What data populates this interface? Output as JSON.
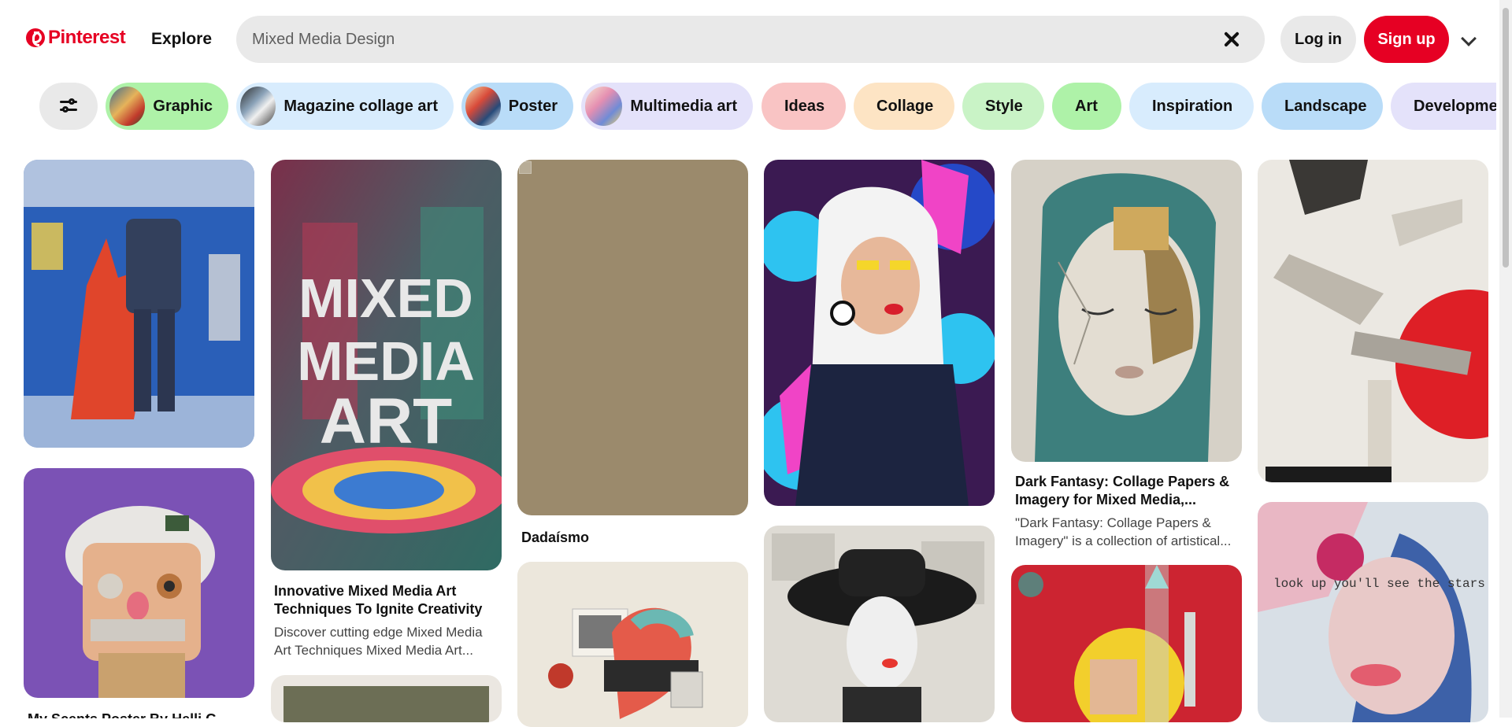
{
  "header": {
    "logo_text": "Pinterest",
    "explore_label": "Explore",
    "search_value": "Mixed Media Design",
    "login_label": "Log in",
    "signup_label": "Sign up"
  },
  "chips": [
    {
      "label": "Graphic",
      "bg": "#aef2a8"
    },
    {
      "label": "Magazine collage art",
      "bg": "#d8ecfd"
    },
    {
      "label": "Poster",
      "bg": "#b9dcf8"
    },
    {
      "label": "Multimedia art",
      "bg": "#e4e2fa"
    },
    {
      "label": "Ideas",
      "bg": "#f9c4c4"
    },
    {
      "label": "Collage",
      "bg": "#fde4c4"
    },
    {
      "label": "Style",
      "bg": "#c9f3c6"
    },
    {
      "label": "Art",
      "bg": "#aef2a8"
    },
    {
      "label": "Inspiration",
      "bg": "#d8ecfd"
    },
    {
      "label": "Landscape",
      "bg": "#b9dcf8"
    },
    {
      "label": "Development",
      "bg": "#e4e2fa"
    }
  ],
  "pins": {
    "p2_title": "Innovative Mixed Media Art Techniques To Ignite Creativity",
    "p2_desc": "Discover cutting edge Mixed Media Art Techniques Mixed Media Art...",
    "p2_image_text": [
      "MIXED",
      "MEDIA",
      "ART"
    ],
    "p3_title": "Dadaísmo",
    "p5_title": "Dark Fantasy: Collage Papers & Imagery for Mixed Media,...",
    "p5_desc": "\"Dark Fantasy: Collage Papers & Imagery\" is a collection of artistical...",
    "p7_title": "My Scents Poster By Helli G...",
    "p9_image_text": "look up you'll see the stars"
  },
  "colors": {
    "brand": "#e60023",
    "dadaismo_placeholder": "#9b8a6c"
  },
  "icons": {
    "clear": "close-icon",
    "filter": "sliders-icon",
    "menu": "chevron-down-icon"
  }
}
